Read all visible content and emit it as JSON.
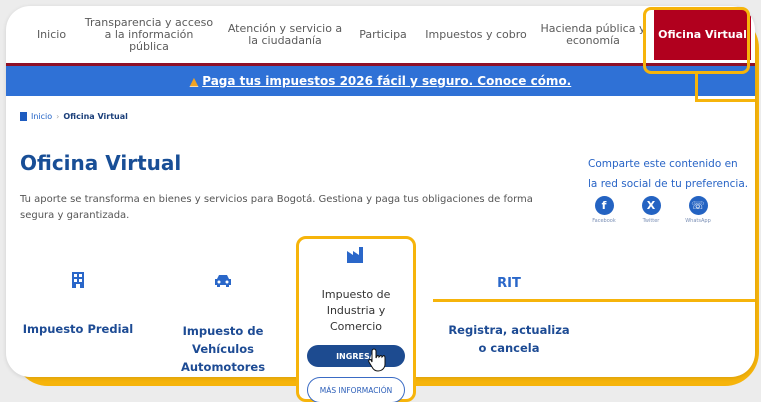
{
  "nav": {
    "items": [
      {
        "label": "Inicio"
      },
      {
        "label": "Transparencia y acceso a la información pública"
      },
      {
        "label": "Atención y servicio a la ciudadanía"
      },
      {
        "label": "Participa"
      },
      {
        "label": "Impuestos y cobro"
      },
      {
        "label": "Hacienda pública y economía"
      },
      {
        "label": "Oficina Virtual"
      }
    ],
    "active_index": 6
  },
  "banner": {
    "icon": "warning-icon",
    "text": "Paga tus impuestos 2026 fácil y seguro. Conoce cómo."
  },
  "breadcrumb": {
    "home": "Inicio",
    "current": "Oficina Virtual"
  },
  "page": {
    "title": "Oficina Virtual",
    "description": "Tu aporte se transforma en bienes y servicios para Bogotá. Gestiona y paga tus obligaciones de forma segura y garantizada."
  },
  "share": {
    "text": "Comparte este contenido en la red social de tu preferencia.",
    "items": [
      {
        "label": "Facebook",
        "icon": "facebook-icon",
        "glyph": "f"
      },
      {
        "label": "Twitter",
        "icon": "x-icon",
        "glyph": "X"
      },
      {
        "label": "WhatsApp",
        "icon": "whatsapp-icon",
        "glyph": "☏"
      }
    ]
  },
  "services": {
    "predial": {
      "label": "Impuesto Predial",
      "icon": "building-icon"
    },
    "vehiculos": {
      "label": "Impuesto de Vehículos Automotores",
      "icon": "car-icon"
    },
    "ica": {
      "label": "Impuesto de Industria y Comercio",
      "icon": "factory-icon",
      "primary": "INGRESA",
      "secondary": "MÁS INFORMACIÓN"
    },
    "rit": {
      "icon_text": "RIT",
      "label": "Registra, actualiza o cancela"
    }
  },
  "colors": {
    "accent": "#b1001e",
    "blue": "#2f71d6",
    "highlight": "#f6b40b",
    "title": "#184e96"
  }
}
